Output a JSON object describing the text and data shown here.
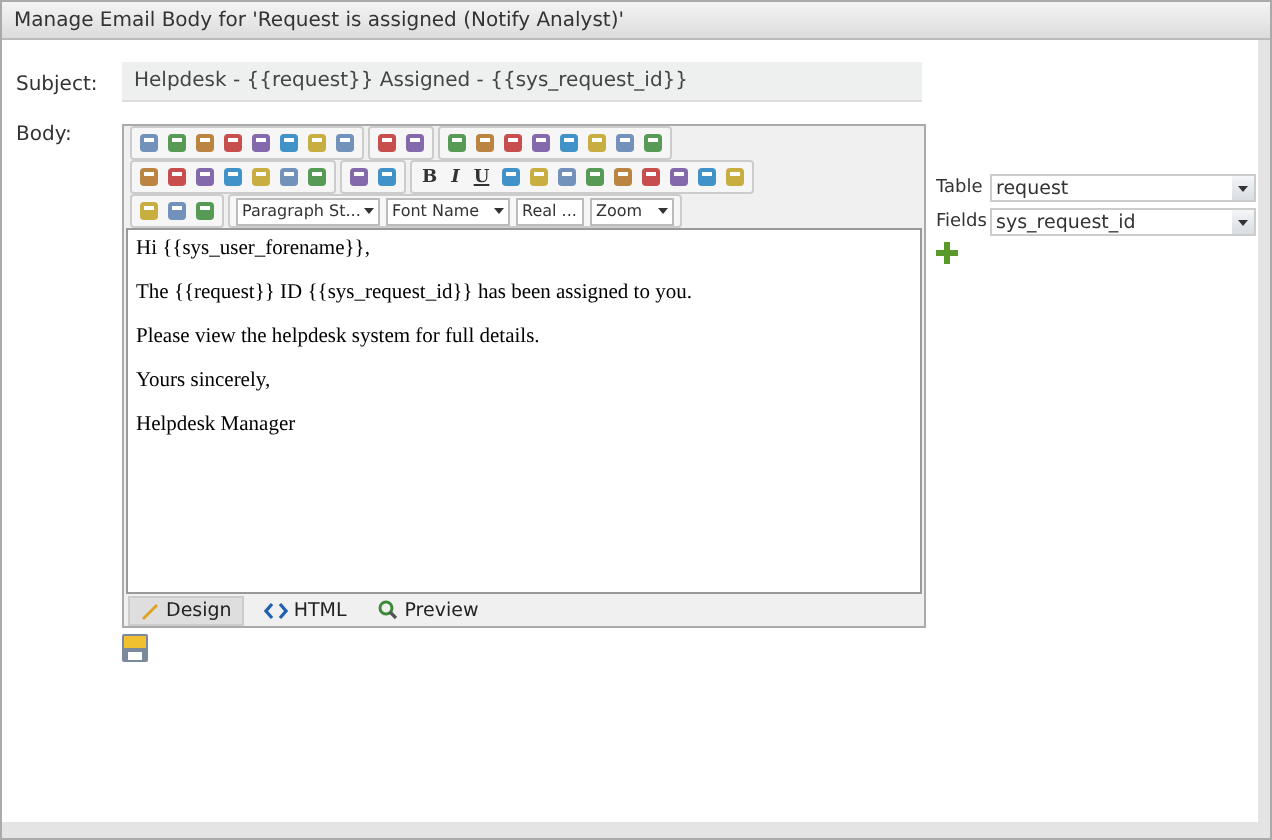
{
  "window": {
    "title": "Manage Email Body for 'Request is assigned (Notify Analyst)'"
  },
  "subject": {
    "label": "Subject:",
    "value": "Helpdesk - {{request}} Assigned - {{sys_request_id}}"
  },
  "body": {
    "label": "Body:",
    "format_buttons": [
      "B",
      "I",
      "U"
    ],
    "dropdowns": [
      "Paragraph St...",
      "Font Name",
      "Real ...",
      "Zoom"
    ],
    "paragraphs": [
      "Hi {{sys_user_forename}},",
      "The {{request}} ID {{sys_request_id}} has been assigned to you.",
      "Please view the helpdesk system for full details.",
      "Yours sincerely,",
      "Helpdesk Manager"
    ],
    "modes": [
      {
        "label": "Design",
        "kind": "design",
        "selected": true
      },
      {
        "label": "HTML",
        "kind": "html",
        "selected": false
      },
      {
        "label": "Preview",
        "kind": "preview",
        "selected": false
      }
    ]
  },
  "fields_panel": {
    "table_label": "Table",
    "table_value": "request",
    "fields_label": "Fields",
    "fields_value": "sys_request_id"
  }
}
